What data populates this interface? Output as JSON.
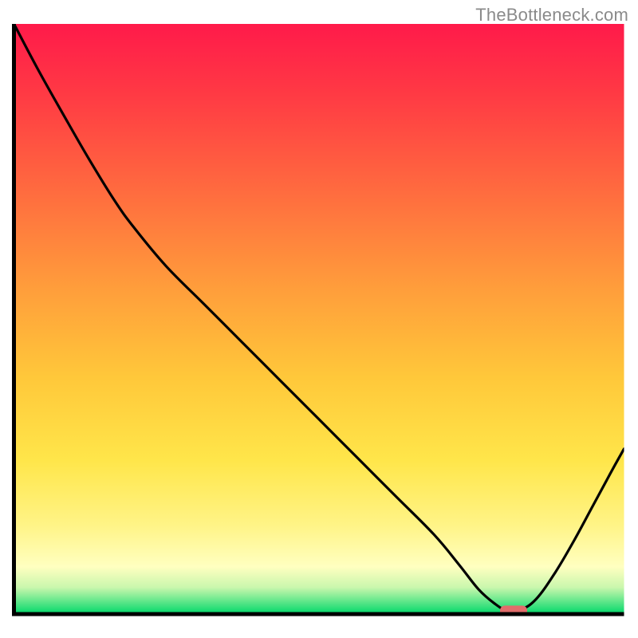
{
  "watermark": "TheBottleneck.com",
  "chart_data": {
    "type": "line",
    "title": "",
    "xlabel": "",
    "ylabel": "",
    "xlim": [
      0,
      100
    ],
    "ylim": [
      0,
      100
    ],
    "background_gradient_colors": [
      "#ff1744",
      "#ff7a3d",
      "#ffd840",
      "#fff176",
      "#ffffcc",
      "#00e676"
    ],
    "curve_points_normalized": [
      {
        "x": 0.0219,
        "y": 1.0
      },
      {
        "x": 0.06,
        "y": 0.922
      },
      {
        "x": 0.1,
        "y": 0.845
      },
      {
        "x": 0.14,
        "y": 0.77
      },
      {
        "x": 0.18,
        "y": 0.7
      },
      {
        "x": 0.21,
        "y": 0.655
      },
      {
        "x": 0.26,
        "y": 0.59
      },
      {
        "x": 0.32,
        "y": 0.525
      },
      {
        "x": 0.38,
        "y": 0.46
      },
      {
        "x": 0.44,
        "y": 0.395
      },
      {
        "x": 0.5,
        "y": 0.33
      },
      {
        "x": 0.56,
        "y": 0.265
      },
      {
        "x": 0.62,
        "y": 0.2
      },
      {
        "x": 0.68,
        "y": 0.135
      },
      {
        "x": 0.72,
        "y": 0.083
      },
      {
        "x": 0.75,
        "y": 0.042
      },
      {
        "x": 0.775,
        "y": 0.018
      },
      {
        "x": 0.793,
        "y": 0.007
      },
      {
        "x": 0.815,
        "y": 0.007
      },
      {
        "x": 0.84,
        "y": 0.025
      },
      {
        "x": 0.87,
        "y": 0.07
      },
      {
        "x": 0.9,
        "y": 0.125
      },
      {
        "x": 0.93,
        "y": 0.185
      },
      {
        "x": 0.96,
        "y": 0.245
      },
      {
        "x": 0.9781,
        "y": 0.28
      }
    ],
    "marker": {
      "x_norm": 0.805,
      "y_norm": 0.0055,
      "color": "#e26d6b"
    },
    "plot_area_fraction": {
      "x0": 0.0219,
      "y0": 0.0375,
      "x1": 0.9781,
      "y1": 0.9625
    }
  }
}
